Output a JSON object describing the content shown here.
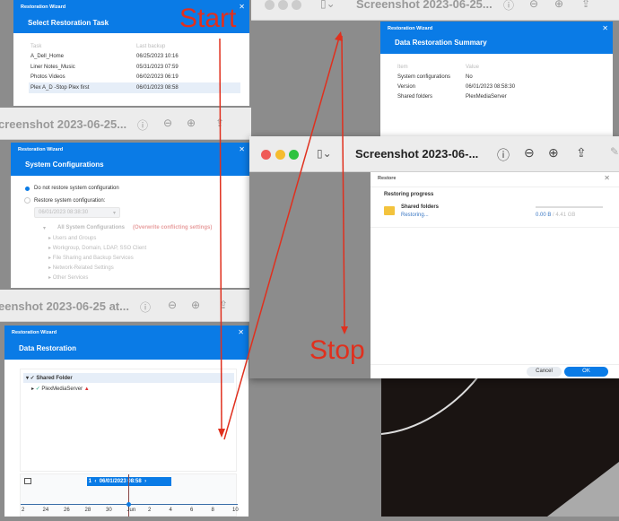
{
  "task_dialog": {
    "wizard": "Restoration Wizard",
    "title": "Select Restoration Task",
    "col_task": "Task",
    "col_backup": "Last backup",
    "rows": [
      {
        "task": "A_Dell_Home",
        "backup": "06/25/2023 10:16"
      },
      {
        "task": "Liner Notes_Music",
        "backup": "05/31/2023 07:59"
      },
      {
        "task": "Photos Videos",
        "backup": "06/02/2023 06:19"
      },
      {
        "task": "Plex A_D -Stop Plex first",
        "backup": "06/01/2023 08:58"
      }
    ]
  },
  "window_b": {
    "title": "creenshot 2023-06-25..."
  },
  "sys_dialog": {
    "wizard": "Restoration Wizard",
    "title": "System Configurations",
    "opt1": "Do not restore system configuration",
    "opt2": "Restore system configuration:",
    "version": "06/01/2023 08:38:30",
    "all": "All System Configurations",
    "overwrite": "(Overwrite conflicting settings)",
    "items": [
      "Users and Groups",
      "Workgroup, Domain, LDAP, SSO Client",
      "File Sharing and Backup Services",
      "Network-Related Settings",
      "Other Services"
    ]
  },
  "window_c": {
    "title": "eenshot 2023-06-25 at..."
  },
  "data_dialog": {
    "wizard": "Restoration Wizard",
    "title": "Data Restoration",
    "folder": "Shared Folder",
    "sub": "PlexMediaServer",
    "page": "1",
    "date": "06/01/2023 08:58",
    "ticks": [
      "2",
      "24",
      "26",
      "28",
      "30",
      "Jun",
      "2",
      "4",
      "6",
      "8",
      "10"
    ]
  },
  "window_tr": {
    "title": "Screenshot 2023-06-25..."
  },
  "summary_dialog": {
    "wizard": "Restoration Wizard",
    "title": "Data Restoration Summary",
    "col_item": "Item",
    "col_value": "Value",
    "rows": [
      {
        "item": "System configurations",
        "value": "No"
      },
      {
        "item": "Version",
        "value": "06/01/2023 08:58:30"
      },
      {
        "item": "Shared folders",
        "value": "PlexMediaServer"
      }
    ]
  },
  "window_mid": {
    "title": "Screenshot 2023-06-..."
  },
  "restore_dialog": {
    "title": "Restore",
    "section": "Restoring progress",
    "item": "Shared folders",
    "status": "Restoring...",
    "done": "0.00 B",
    "total": " / 4.41 GB",
    "progress": 0,
    "cancel": "Cancel",
    "ok": "OK"
  },
  "annotations": {
    "start": "Start",
    "stop": "Stop"
  }
}
